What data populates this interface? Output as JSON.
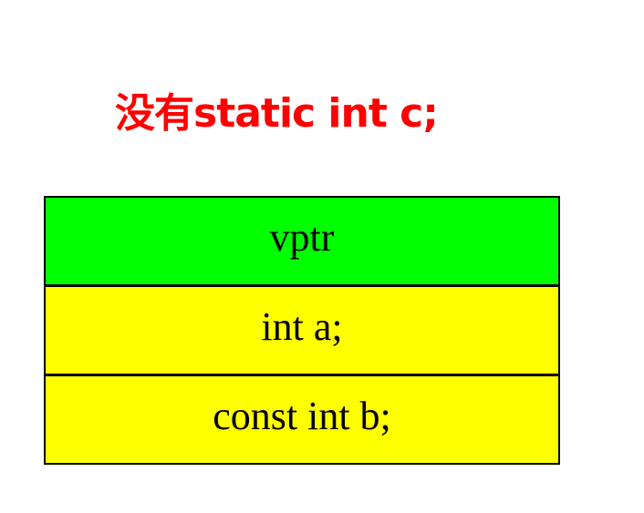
{
  "title": "没有static int c;",
  "colors": {
    "title": "#ff0000",
    "vptr_fill": "#00ff00",
    "member_fill": "#ffff00",
    "border": "#000000"
  },
  "cells": [
    {
      "label": "vptr",
      "fill": "#00ff00"
    },
    {
      "label": "int a;",
      "fill": "#ffff00"
    },
    {
      "label": "const int b;",
      "fill": "#ffff00"
    }
  ]
}
